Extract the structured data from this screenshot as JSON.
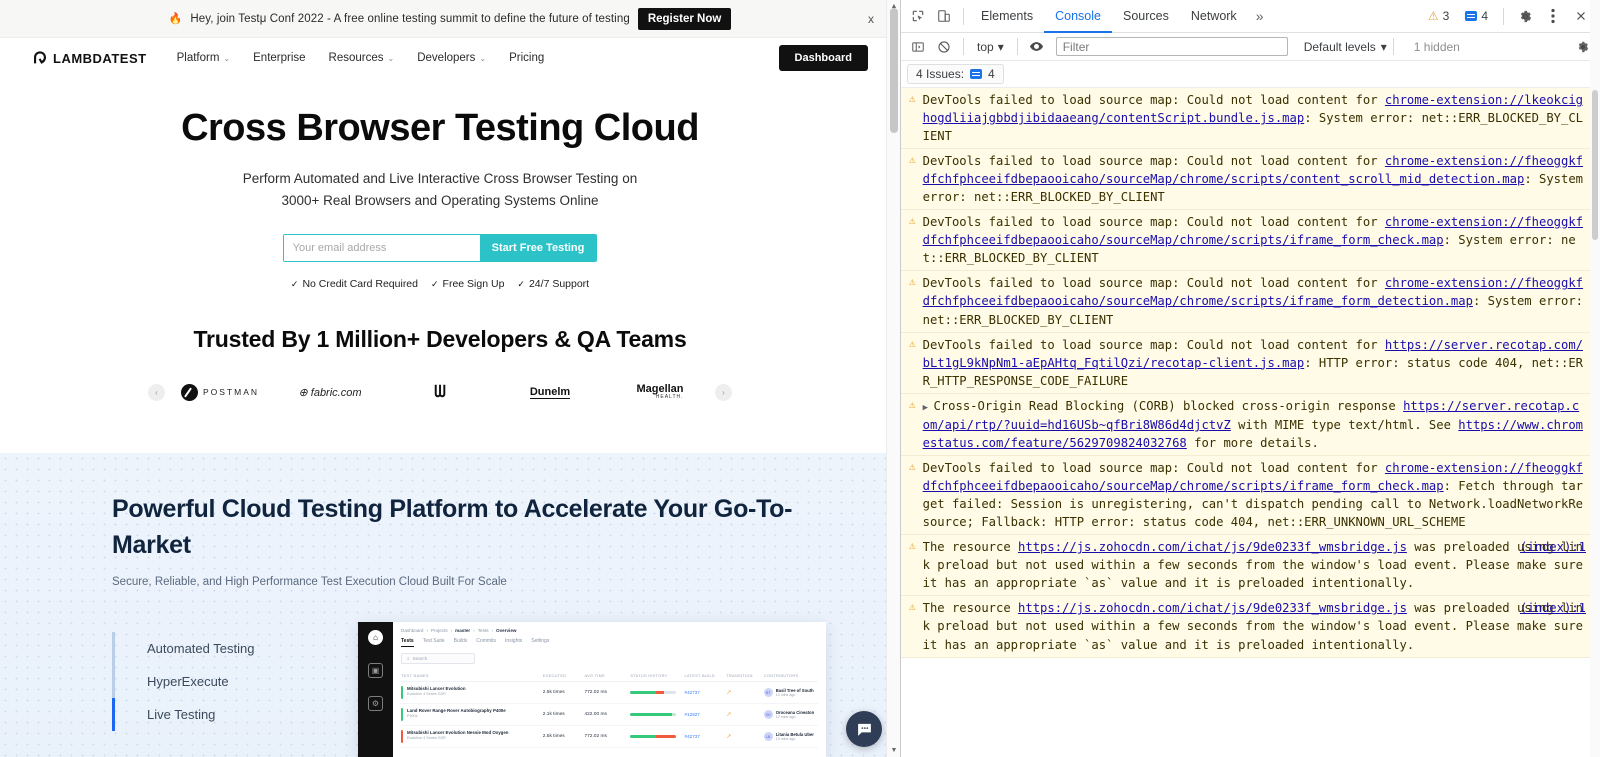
{
  "page": {
    "banner": {
      "emoji": "🔥",
      "text": "Hey, join Testμ Conf 2022 - A free online testing summit to define the future of testing",
      "cta": "Register Now",
      "close": "x"
    },
    "nav": {
      "logo_text": "LAMBDATEST",
      "links": [
        {
          "label": "Platform",
          "caret": "⌄"
        },
        {
          "label": "Enterprise",
          "caret": ""
        },
        {
          "label": "Resources",
          "caret": "⌄"
        },
        {
          "label": "Developers",
          "caret": "⌄"
        },
        {
          "label": "Pricing",
          "caret": ""
        }
      ],
      "dashboard_label": "Dashboard"
    },
    "hero": {
      "title": "Cross Browser Testing Cloud",
      "subtitle_line1": "Perform Automated and Live Interactive Cross Browser Testing on",
      "subtitle_line2": "3000+ Real Browsers and Operating Systems Online",
      "email_placeholder": "Your email address",
      "email_value": "",
      "cta_label": "Start Free Testing",
      "perks": [
        "No Credit Card Required",
        "Free Sign Up",
        "24/7 Support"
      ],
      "tick": "✓"
    },
    "trusted": {
      "title": "Trusted By 1 Million+ Developers & QA Teams",
      "prev": "‹",
      "next": "›",
      "logos": [
        {
          "name": "postman",
          "label": "POSTMAN"
        },
        {
          "name": "fabric-com",
          "label": "fabric.com"
        },
        {
          "name": "unknown-brand",
          "label": "ᗯ"
        },
        {
          "name": "dunelm",
          "label": "Dunelm"
        },
        {
          "name": "magellan-health",
          "label": "Magellan",
          "sub": "HEALTH."
        }
      ]
    },
    "section2": {
      "heading": "Powerful Cloud Testing Platform to Accelerate Your Go-To-Market",
      "subheading": "Secure, Reliable, and High Performance Test Execution Cloud Built For Scale",
      "features": [
        "Automated Testing",
        "HyperExecute",
        "Live Testing"
      ]
    },
    "screenshot": {
      "breadcrumbs": [
        "Dashboard",
        "Projects",
        "master",
        "Tests",
        "Overview"
      ],
      "tabs": [
        "Tests",
        "Test Suite",
        "Builds",
        "Commits",
        "Insights",
        "Settings"
      ],
      "active_tab": "Tests",
      "search_placeholder": "Search",
      "columns": [
        "TEST NAMES",
        "EXECUTED",
        "AVG TIME",
        "STATUS HISTORY",
        "LATEST BUILD",
        "TRANSITION",
        "CONTRIBUTORS"
      ],
      "rows": [
        {
          "name": "Mitsubishi Lancer Evolution",
          "sub": "Evolution 4 Series GSR",
          "executed": "2.5k times",
          "avg_time": "772.02 ms",
          "latest_build": "#42737",
          "contributor": "Basil Tree of South",
          "ago": "10 mins ago",
          "initials": "BT",
          "status": "mixed"
        },
        {
          "name": "Land Rover Range Rover Autobiography P400e",
          "sub": "P400e",
          "executed": "2.1k times",
          "avg_time": "422.00 ms",
          "latest_build": "#12827",
          "contributor": "Oroceana Cineaton",
          "ago": "12 mins ago",
          "initials": "OC",
          "status": "pass"
        },
        {
          "name": "Mitsubishi Lancer Evolution Nessie Mod Oxygen",
          "sub": "Evolution 4 Series GSR",
          "executed": "2.5k times",
          "avg_time": "772.02 ms",
          "latest_build": "#42737",
          "contributor": "Litania Betula Uber",
          "ago": "10 mins ago",
          "initials": "LB",
          "status": "mixed"
        }
      ]
    },
    "chat_widget": {
      "name": "chat-bubble"
    }
  },
  "devtools": {
    "tabs": [
      "Elements",
      "Console",
      "Sources",
      "Network"
    ],
    "active_tab": "Console",
    "more_tabs": "»",
    "warning_count": "3",
    "issue_count": "4",
    "toolbar": {
      "context": "top",
      "context_caret": "▾",
      "filter_placeholder": "Filter",
      "filter_value": "",
      "levels": "Default levels",
      "levels_caret": "▾",
      "hidden": "1 hidden"
    },
    "issues_bar": {
      "label": "4 Issues:",
      "count": "4"
    },
    "messages": [
      {
        "expandable": false,
        "source": "",
        "parts": [
          {
            "t": "DevTools failed to load source map: Could not load content for ",
            "link": false
          },
          {
            "t": "chrome-extension://lkeokcighogdliiajgbbdjibidaaeang/contentScript.bundle.js.map",
            "link": true
          },
          {
            "t": ": System error: net::ERR_BLOCKED_BY_CLIENT",
            "link": false
          }
        ]
      },
      {
        "expandable": false,
        "source": "",
        "parts": [
          {
            "t": "DevTools failed to load source map: Could not load content for ",
            "link": false
          },
          {
            "t": "chrome-extension://fheoggkfdfchfphceeifdbepaooicaho/sourceMap/chrome/scripts/content_scroll_mid_detection.map",
            "link": true
          },
          {
            "t": ": System error: net::ERR_BLOCKED_BY_CLIENT",
            "link": false
          }
        ]
      },
      {
        "expandable": false,
        "source": "",
        "parts": [
          {
            "t": "DevTools failed to load source map: Could not load content for ",
            "link": false
          },
          {
            "t": "chrome-extension://fheoggkfdfchfphceeifdbepaooicaho/sourceMap/chrome/scripts/iframe_form_check.map",
            "link": true
          },
          {
            "t": ": System error: net::ERR_BLOCKED_BY_CLIENT",
            "link": false
          }
        ]
      },
      {
        "expandable": false,
        "source": "",
        "parts": [
          {
            "t": "DevTools failed to load source map: Could not load content for ",
            "link": false
          },
          {
            "t": "chrome-extension://fheoggkfdfchfphceeifdbepaooicaho/sourceMap/chrome/scripts/iframe_form_detection.map",
            "link": true
          },
          {
            "t": ": System error: net::ERR_BLOCKED_BY_CLIENT",
            "link": false
          }
        ]
      },
      {
        "expandable": false,
        "source": "",
        "parts": [
          {
            "t": "DevTools failed to load source map: Could not load content for ",
            "link": false
          },
          {
            "t": "https://server.recotap.com/bLt1gL9kNpNm1-aEpAHtq_FqtilQzi/recotap-client.js.map",
            "link": true
          },
          {
            "t": ": HTTP error: status code 404, net::ERR_HTTP_RESPONSE_CODE_FAILURE",
            "link": false
          }
        ]
      },
      {
        "expandable": true,
        "source": "",
        "parts": [
          {
            "t": "Cross-Origin Read Blocking (CORB) blocked cross-origin response ",
            "link": false
          },
          {
            "t": "https://server.recotap.com/api/rtp/?uuid=hd16USb~qfBri8W86d4djctvZ",
            "link": true
          },
          {
            "t": " with MIME type text/html. See ",
            "link": false
          },
          {
            "t": "https://www.chromestatus.com/feature/5629709824032768",
            "link": true
          },
          {
            "t": " for more details.",
            "link": false
          }
        ]
      },
      {
        "expandable": false,
        "source": "",
        "parts": [
          {
            "t": "DevTools failed to load source map: Could not load content for ",
            "link": false
          },
          {
            "t": "chrome-extension://fheoggkfdfchfphceeifdbepaooicaho/sourceMap/chrome/scripts/iframe_form_check.map",
            "link": true
          },
          {
            "t": ": Fetch through target failed: Session is unregistering, can't dispatch pending call to Network.loadNetworkResource; Fallback: HTTP error: status code 404, net::ERR_UNKNOWN_URL_SCHEME",
            "link": false
          }
        ]
      },
      {
        "expandable": false,
        "source": "(index):1",
        "parts": [
          {
            "t": "The resource ",
            "link": false
          },
          {
            "t": "https://js.zohocdn.com/ichat/js/9de0233f_wmsbridge.js",
            "link": true
          },
          {
            "t": " was preloaded using link preload but not used within a few seconds from the window's load event. Please make sure it has an appropriate `as` value and it is preloaded intentionally.",
            "link": false
          }
        ]
      },
      {
        "expandable": false,
        "source": "(index):1",
        "parts": [
          {
            "t": "The resource ",
            "link": false
          },
          {
            "t": "https://js.zohocdn.com/ichat/js/9de0233f_wmsbridge.js",
            "link": true
          },
          {
            "t": " was preloaded using link preload but not used within a few seconds from the window's load event. Please make sure it has an appropriate `as` value and it is preloaded intentionally.",
            "link": false
          }
        ]
      }
    ]
  },
  "colors": {
    "accent_teal": "#2bc3c8",
    "devtools_blue": "#1a73e8",
    "warning_bg": "#fffbe6",
    "warning_icon": "#e0a42a",
    "link": "#1a0dab",
    "dark": "#111111"
  }
}
